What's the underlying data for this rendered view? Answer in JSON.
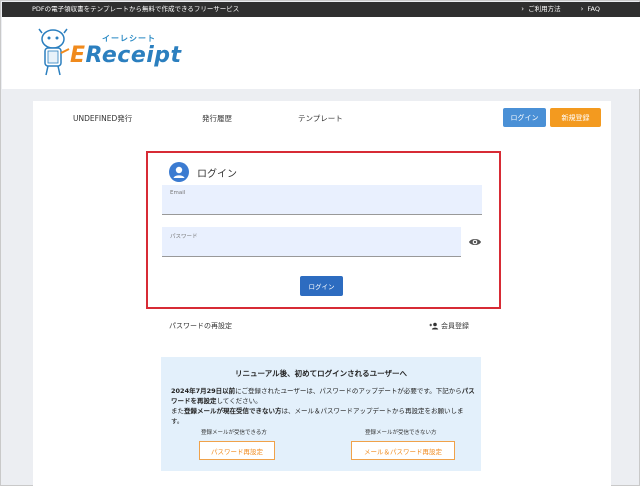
{
  "topbar": {
    "tagline": "PDFの電子領収書をテンプレートから無料で作成できるフリーサービス",
    "links": [
      {
        "icon": "chevron-right-icon",
        "label": "ご利用方法"
      },
      {
        "icon": "chevron-right-icon",
        "label": "FAQ"
      }
    ]
  },
  "logo": {
    "kana": "イーレシート",
    "word_first": "E",
    "word_rest": "Receipt"
  },
  "nav": {
    "items": [
      "UNDEFINED発行",
      "発行履歴",
      "テンプレート"
    ],
    "login": "ログイン",
    "register": "新規登録"
  },
  "login": {
    "title": "ログイン",
    "email_label": "Email",
    "password_label": "パスワード",
    "submit": "ログイン"
  },
  "links": {
    "reset_password": "パスワードの再設定",
    "member_register": "会員登録"
  },
  "notice": {
    "title": "リニューアル後、初めてログインされるユーザーへ",
    "line1_pre": "2024年7月29日以前",
    "line1_post": "にご登録されたユーザーは、パスワードのアップデートが必要です。下記から",
    "line2_bold": "パスワードを再設定",
    "line2_post": "してください。",
    "line3_pre": "また",
    "line3_bold": "登録メールが現在受信できない方",
    "line3_post": "は、メール＆パスワードアップデートから再設定をお願いします。",
    "left_label": "登録メールが受信できる方",
    "right_label": "登録メールが受信できない方",
    "left_button": "パスワード再設定",
    "right_button": "メール＆パスワード再設定"
  },
  "colors": {
    "accent_blue": "#4a90d6",
    "accent_orange": "#f39a1f",
    "highlight_red": "#d72b35"
  }
}
